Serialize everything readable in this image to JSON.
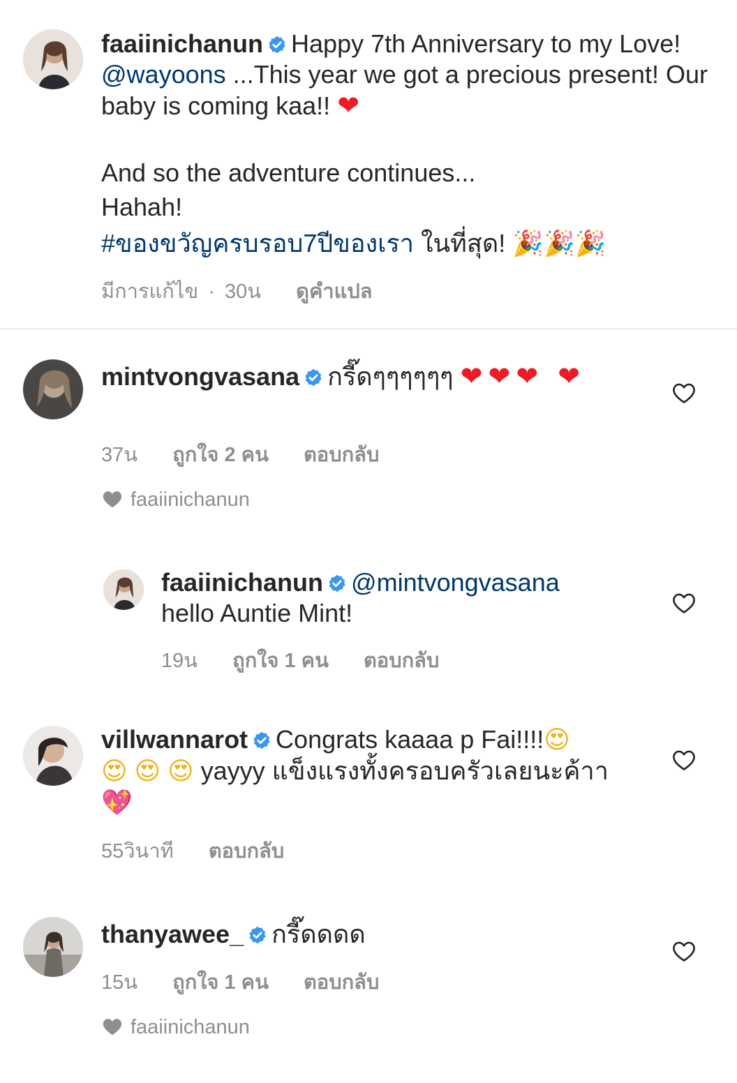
{
  "caption": {
    "username": "faaiinichanun",
    "text_part1": "Happy 7th Anniversary to my Love!",
    "mention": "@wayoons",
    "text_part2": "...This year we got a precious present! Our baby is coming kaa!!",
    "heart": "❤",
    "line2": "And so the adventure continues...",
    "line3": "Hahah!",
    "hashtag": "#ของขวัญครบรอบ7ปีของเรา",
    "line4_text": "ในที่สุด!",
    "party_emojis": "🎉🎉🎉",
    "edited": "มีการแก้ไข",
    "separator": "·",
    "time": "30น",
    "translate": "ดูคำแปล"
  },
  "comments": [
    {
      "username": "mintvongvasana",
      "text": "กรี๊ดๆๆๆๆๆๆ",
      "emojis": "❤❤❤ ❤",
      "time": "37น",
      "likes": "ถูกใจ 2 คน",
      "reply": "ตอบกลับ",
      "liked_by": "faaiinichanun"
    },
    {
      "username": "faaiinichanun",
      "mention": "@mintvongvasana",
      "text": "hello Auntie Mint!",
      "time": "19น",
      "likes": "ถูกใจ 1 คน",
      "reply": "ตอบกลับ"
    },
    {
      "username": "villwannarot",
      "text_part1": "Congrats kaaaa p Fai!!!!",
      "emoji_face": "😍",
      "text_part2": "yayyy แข็งแรงทั้งครอบครัวเลยนะค้าา",
      "emoji_sparkle": "💖",
      "time": "55วินาที",
      "reply": "ตอบกลับ"
    },
    {
      "username": "thanyawee_",
      "text": "กรี๊ดดดด",
      "time": "15น",
      "likes": "ถูกใจ 1 คน",
      "reply": "ตอบกลับ",
      "liked_by": "faaiinichanun"
    }
  ],
  "colors": {
    "text": "#262626",
    "secondary": "#8e8e8e",
    "link": "#00376b",
    "verified": "#3897f0",
    "divider": "#dbdbdb"
  },
  "icons": {
    "verified": "verified-badge-icon",
    "like": "heart-outline-icon",
    "liked_by": "heart-filled-icon"
  }
}
